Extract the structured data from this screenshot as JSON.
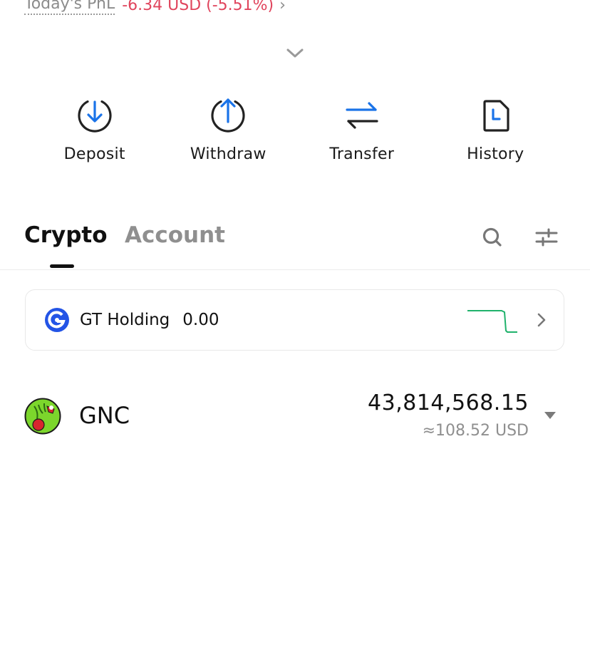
{
  "pnl": {
    "label": "Today's PnL",
    "value": "-6.34 USD (-5.51%)",
    "value_color": "#e0455d"
  },
  "actions": [
    {
      "label": "Deposit",
      "icon": "download-circle-icon"
    },
    {
      "label": "Withdraw",
      "icon": "upload-circle-icon"
    },
    {
      "label": "Transfer",
      "icon": "swap-arrows-icon"
    },
    {
      "label": "History",
      "icon": "document-clock-icon"
    }
  ],
  "tabs": {
    "crypto": "Crypto",
    "account": "Account",
    "active": "Crypto"
  },
  "gt_holding": {
    "label": "GT Holding",
    "value": "0.00",
    "sparkline_color": "#20b26c",
    "logo_color": "#2354e6"
  },
  "assets": [
    {
      "symbol": "GNC",
      "amount": "43,814,568.15",
      "fiat": "≈108.52 USD",
      "icon": "gnc-coin-icon"
    }
  ]
}
